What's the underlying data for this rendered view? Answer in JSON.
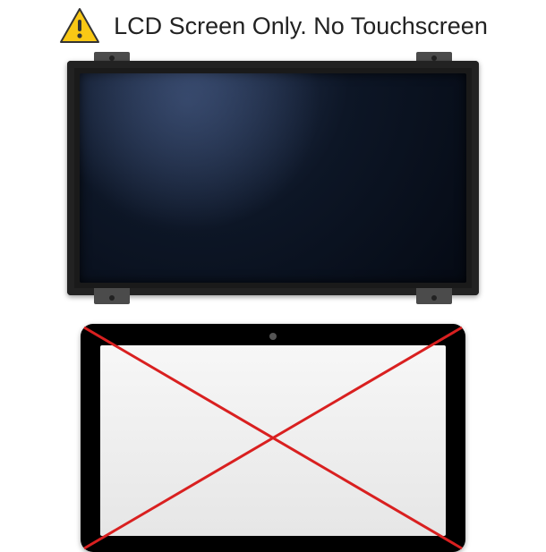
{
  "header": {
    "text": "LCD Screen Only. No Touchscreen",
    "icon": "warning-icon"
  },
  "colors": {
    "warning_bg": "#F9C815",
    "warning_border": "#333333",
    "cross": "#D92020",
    "screen_dark": "#0d1626"
  }
}
